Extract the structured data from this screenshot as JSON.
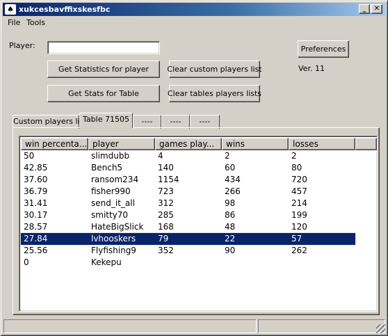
{
  "window": {
    "title": "xukcesbavffixskesfbc"
  },
  "titlebar_buttons": {
    "minimize": "_",
    "maximize": "□",
    "close": "✕"
  },
  "menu": {
    "file": "File",
    "tools": "Tools"
  },
  "form": {
    "player_label": "Player:",
    "player_value": "",
    "get_stats_player": "Get Statistics for player",
    "clear_custom": "Clear custom players list",
    "get_stats_table": "Get Stats for Table",
    "clear_tables": "Clear tables players lists",
    "preferences": "Preferences",
    "version": "Ver. 11"
  },
  "tabs": [
    {
      "label": "Custom players list"
    },
    {
      "label": "Table  71505"
    },
    {
      "label": "----"
    },
    {
      "label": "----"
    },
    {
      "label": "----"
    }
  ],
  "table": {
    "columns": [
      "win percenta...",
      "player",
      "games play...",
      "wins",
      "losses"
    ],
    "rows": [
      [
        "50",
        "slimdubb",
        "4",
        "2",
        "2"
      ],
      [
        "42.85",
        "Bench5",
        "140",
        "60",
        "80"
      ],
      [
        "37.60",
        "ransom234",
        "1154",
        "434",
        "720"
      ],
      [
        "36.79",
        "fisher990",
        "723",
        "266",
        "457"
      ],
      [
        "31.41",
        "send_it_all",
        "312",
        "98",
        "214"
      ],
      [
        "30.17",
        "smitty70",
        "285",
        "86",
        "199"
      ],
      [
        "28.57",
        "HateBigSlick",
        "168",
        "48",
        "120"
      ],
      [
        "27.84",
        "lvhooskers",
        "79",
        "22",
        "57"
      ],
      [
        "25.56",
        "Flyfishing9",
        "352",
        "90",
        "262"
      ],
      [
        "0",
        "Kekepu",
        "",
        "",
        ""
      ]
    ],
    "selected_row": 7
  },
  "colors": {
    "selection": "#0a246a",
    "titlebar": "#0a246a",
    "face": "#d4d0c8"
  }
}
